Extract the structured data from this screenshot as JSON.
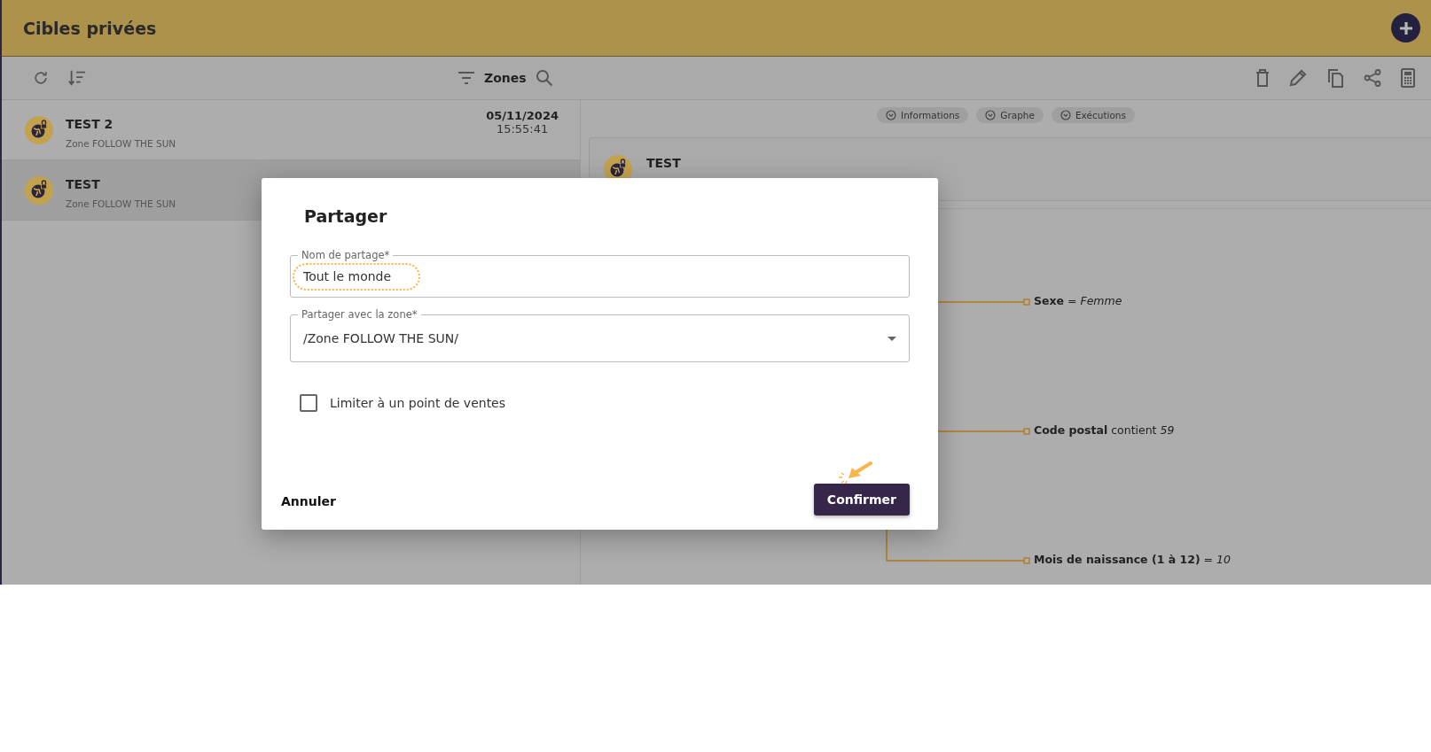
{
  "header": {
    "title": "Cibles privées"
  },
  "toolbar": {
    "filter_label": "Zones"
  },
  "list": [
    {
      "name": "TEST 2",
      "zone": "Zone FOLLOW THE SUN",
      "date": "05/11/2024",
      "time": "15:55:41",
      "selected": false
    },
    {
      "name": "TEST",
      "zone": "Zone FOLLOW THE SUN",
      "selected": true
    }
  ],
  "detail": {
    "sections": [
      {
        "label": "Informations"
      },
      {
        "label": "Graphe"
      },
      {
        "label": "Exécutions"
      }
    ],
    "title": "TEST",
    "conditions": [
      "**Sexe** = *Femme*",
      "**Code postal** contient *59*",
      "**Mois de naissance (1 à 12)** = *10*"
    ]
  },
  "dialog": {
    "title": "Partager",
    "fields": [
      {
        "kind": "text",
        "label": "Nom de partage*",
        "value": "Tout le monde"
      },
      {
        "kind": "select",
        "label": "Partager avec la zone*",
        "value": "/Zone FOLLOW THE SUN/"
      }
    ],
    "checkbox": {
      "label": "Limiter à un point de ventes",
      "checked": false
    },
    "cancel": "Annuler",
    "confirm": "Confirmer"
  }
}
